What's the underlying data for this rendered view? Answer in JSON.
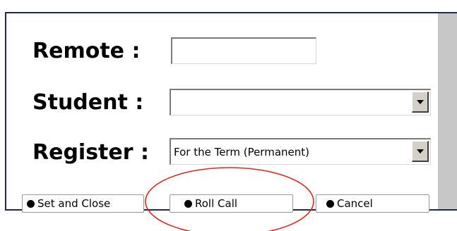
{
  "form": {
    "remote": {
      "label": "Remote :",
      "value": ""
    },
    "student": {
      "label": "Student :",
      "selected": ""
    },
    "register": {
      "label": "Register :",
      "selected": "For the Term (Permanent)"
    }
  },
  "buttons": {
    "set_and_close": "Set and Close",
    "roll_call": "Roll Call",
    "cancel": "Cancel"
  },
  "icons": {
    "dropdown": "triangle-down-icon",
    "button_bullet": "bullet-icon"
  },
  "colors": {
    "panel_border": "#1e2a4a",
    "scrollbar": "#c7c7c7",
    "highlight": "#e3241b"
  }
}
